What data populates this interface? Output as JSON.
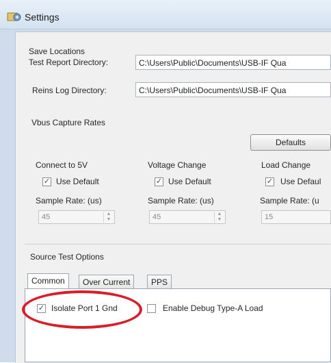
{
  "window": {
    "title": "Settings",
    "icon": "settings-gear-icon"
  },
  "save_locations": {
    "section_label": "Save Locations",
    "test_report": {
      "label": "Test Report Directory:",
      "value": "C:\\Users\\Public\\Documents\\USB-IF Qua"
    },
    "reins_log": {
      "label": "Reins Log Directory:",
      "value": "C:\\Users\\Public\\Documents\\USB-IF Qua"
    }
  },
  "vbus": {
    "section_label": "Vbus Capture Rates",
    "defaults_button": "Defaults",
    "groups": [
      {
        "title": "Connect to 5V",
        "use_default_label": "Use Default",
        "use_default_checked": true,
        "sample_rate_label": "Sample Rate: (us)",
        "sample_rate_value": "45"
      },
      {
        "title": "Voltage Change",
        "use_default_label": "Use Default",
        "use_default_checked": true,
        "sample_rate_label": "Sample Rate: (us)",
        "sample_rate_value": "45"
      },
      {
        "title": "Load Change",
        "use_default_label": "Use Defaul",
        "use_default_checked": true,
        "sample_rate_label": "Sample Rate: (u",
        "sample_rate_value": "15"
      }
    ]
  },
  "source_test": {
    "section_label": "Source Test Options",
    "tabs": [
      "Common",
      "Over Current",
      "PPS"
    ],
    "active_tab": "Common",
    "options": [
      {
        "label": "Isolate Port 1 Gnd",
        "checked": true
      },
      {
        "label": "Enable Debug Type-A Load",
        "checked": false
      }
    ]
  },
  "colors": {
    "highlight_oval": "#d81e2a",
    "title_bar": "#d3e1f0"
  }
}
